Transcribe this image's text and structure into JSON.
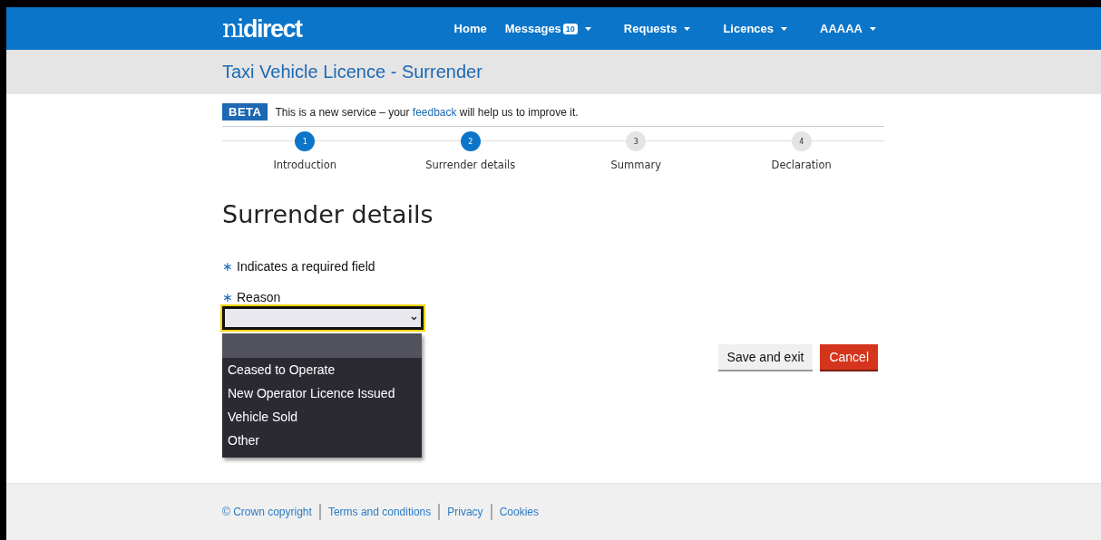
{
  "nav": {
    "logo_light": "ni",
    "logo_bold": "direct",
    "items": [
      {
        "label": "Home",
        "dropdown": false
      },
      {
        "label": "Messages",
        "badge": "10",
        "dropdown": true
      },
      {
        "label": "Requests",
        "dropdown": true
      },
      {
        "label": "Licences",
        "dropdown": true
      },
      {
        "label": "AAAAA",
        "dropdown": true
      }
    ]
  },
  "page_title": "Taxi Vehicle Licence - Surrender",
  "beta": {
    "tag": "BETA",
    "before": "This is a new service – your",
    "link": "feedback",
    "after": "will help us to improve it."
  },
  "steps": [
    {
      "number": "1",
      "label": "Introduction",
      "reached": true
    },
    {
      "number": "2",
      "label": "Surrender details",
      "reached": true
    },
    {
      "number": "3",
      "label": "Summary",
      "reached": false
    },
    {
      "number": "4",
      "label": "Declaration",
      "reached": false
    }
  ],
  "heading": "Surrender details",
  "required_note": {
    "mark": "∗",
    "text": "Indicates a required field"
  },
  "reason": {
    "mark": "∗",
    "label": "Reason",
    "expanded": true,
    "options": [
      {
        "label": "Ceased to Operate",
        "selected": false
      },
      {
        "label": "New Operator Licence Issued",
        "selected": false
      },
      {
        "label": "Vehicle Sold",
        "selected": false
      },
      {
        "label": "Other",
        "selected": false
      }
    ]
  },
  "buttons": [
    {
      "label": "Save and exit",
      "kind": "secondary"
    },
    {
      "label": "Cancel",
      "kind": "danger"
    }
  ],
  "footer": [
    "© Crown copyright",
    "Terms and conditions",
    "Privacy",
    "Cookies"
  ]
}
